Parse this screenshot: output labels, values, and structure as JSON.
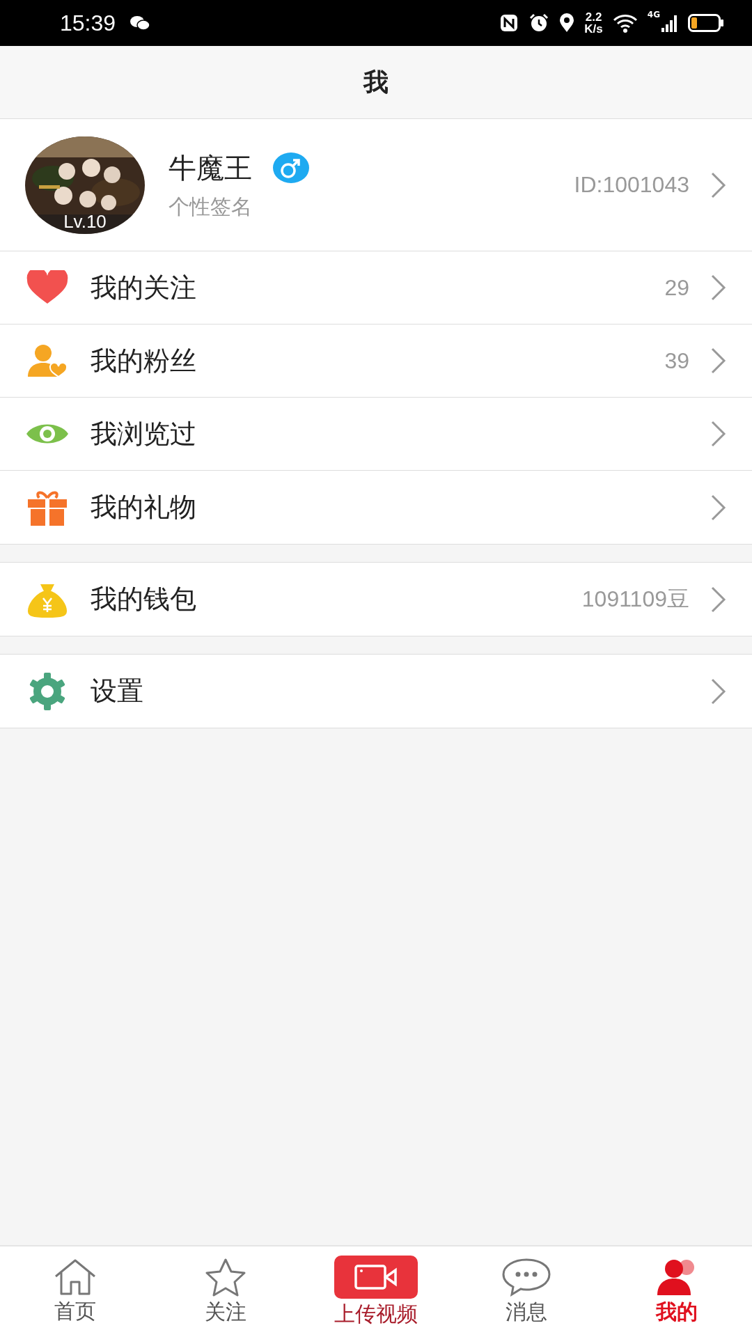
{
  "status_bar": {
    "time": "15:39",
    "speed": "2.2",
    "speed_unit": "K/s",
    "network": "4G"
  },
  "header": {
    "title": "我"
  },
  "profile": {
    "name": "牛魔王",
    "signature": "个性签名",
    "level": "Lv.10",
    "id": "ID:1001043",
    "gender_badge": {
      "kind": "male"
    }
  },
  "groups": [
    {
      "items": [
        {
          "kind": "heart",
          "label": "我的关注",
          "value": "29"
        },
        {
          "kind": "fans",
          "label": "我的粉丝",
          "value": "39"
        },
        {
          "kind": "eye",
          "label": "我浏览过"
        },
        {
          "kind": "gift",
          "label": "我的礼物"
        }
      ]
    },
    {
      "items": [
        {
          "kind": "wallet",
          "label": "我的钱包",
          "value": "1091109豆"
        }
      ]
    },
    {
      "items": [
        {
          "kind": "gear",
          "label": "设置"
        }
      ]
    }
  ],
  "tab_bar": [
    {
      "kind": "home",
      "label": "首页",
      "selected": false
    },
    {
      "kind": "star",
      "label": "关注",
      "selected": false
    },
    {
      "kind": "upload",
      "label": "上传视频",
      "selected": false
    },
    {
      "kind": "chat",
      "label": "消息",
      "selected": false
    },
    {
      "kind": "person",
      "label": "我的",
      "selected": true
    }
  ]
}
